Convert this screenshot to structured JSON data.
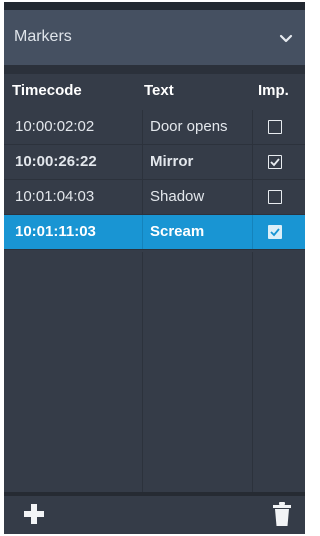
{
  "panel": {
    "title": "Markers",
    "dropdown_icon": "chevron-down-icon"
  },
  "columns": {
    "timecode": "Timecode",
    "text": "Text",
    "imp": "Imp."
  },
  "rows": [
    {
      "timecode": "10:00:02:02",
      "text": "Door opens",
      "imp": false,
      "bold": false,
      "selected": false
    },
    {
      "timecode": "10:00:26:22",
      "text": "Mirror",
      "imp": true,
      "bold": true,
      "selected": false
    },
    {
      "timecode": "10:01:04:03",
      "text": "Shadow",
      "imp": false,
      "bold": false,
      "selected": false
    },
    {
      "timecode": "10:01:11:03",
      "text": "Scream",
      "imp": true,
      "bold": true,
      "selected": true
    }
  ],
  "footer": {
    "add_icon": "plus-icon",
    "delete_icon": "trash-icon"
  },
  "colors": {
    "panel_bg": "#353c48",
    "header_bg": "#455061",
    "selected_bg": "#1995d3"
  }
}
